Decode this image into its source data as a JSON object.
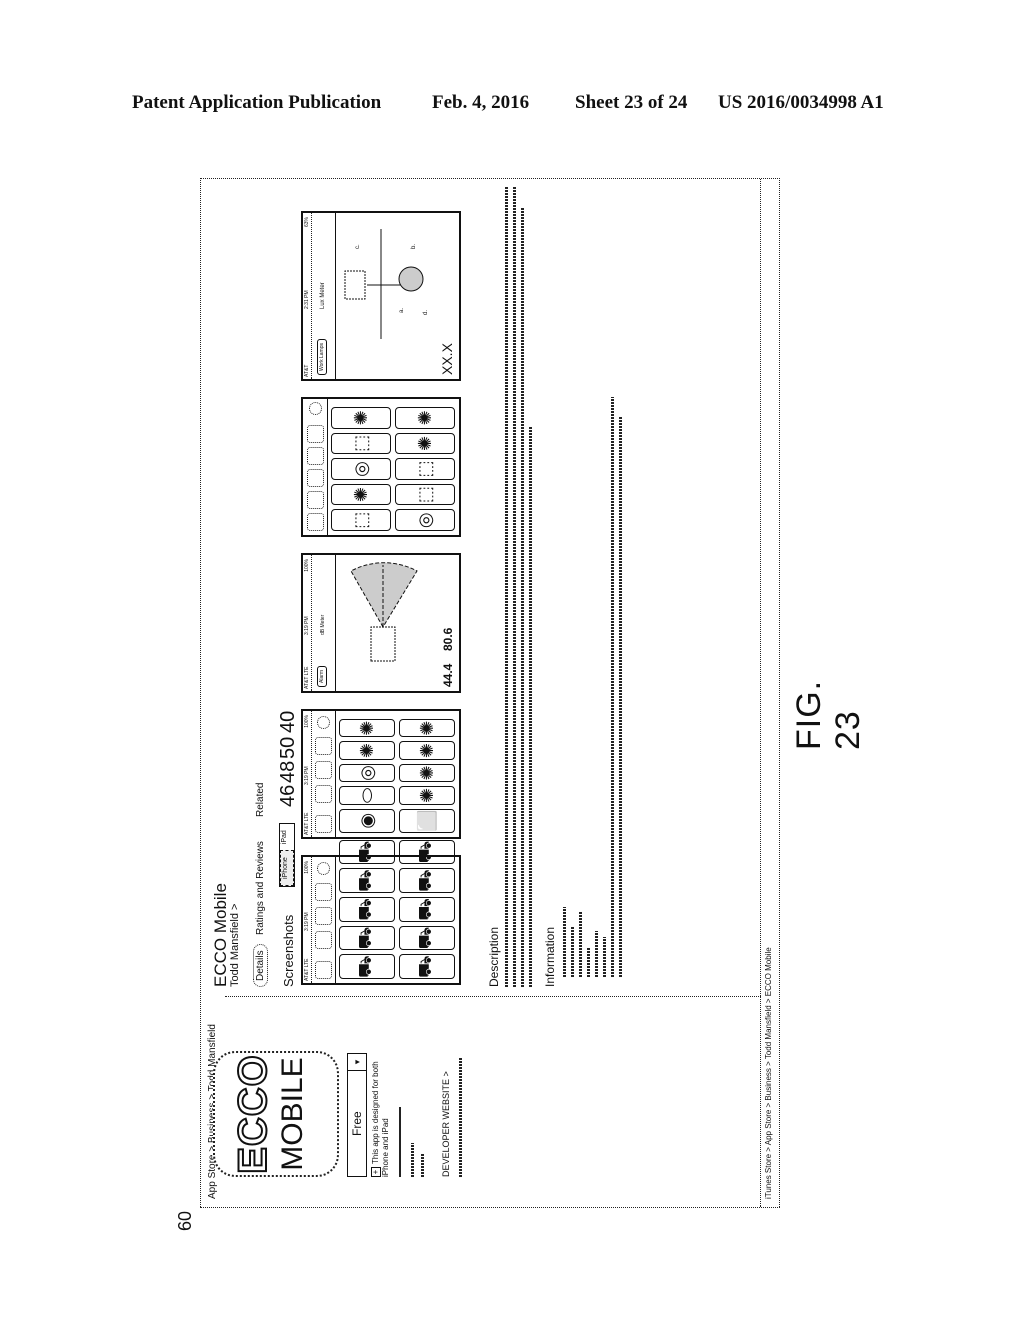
{
  "header": {
    "publication": "Patent Application Publication",
    "date": "Feb. 4, 2016",
    "sheet": "Sheet 23 of 24",
    "number": "US 2016/0034998 A1"
  },
  "figure": {
    "label": "FIG. 23"
  },
  "reference_numerals": {
    "app_icon": "60",
    "toolbar_button_1": "46",
    "toolbar_button_2": "48",
    "toolbar_button_3": "50",
    "toolbar_circle": "40"
  },
  "store": {
    "breadcrumb": "App Store > Business > Todd Mansfield",
    "footer_breadcrumb": "iTunes Store > App Store > Business > Todd Mansfield > ECCO Mobile"
  },
  "sidebar": {
    "icon_text_top": "ECCO",
    "icon_text_bottom": "MOBILE",
    "price_button": "Free",
    "dropdown_icon": "▾",
    "compat_icon": "+",
    "compat_text": "This app is designed for both iPhone and iPad",
    "developer_link": "DEVELOPER WEBSITE >"
  },
  "app": {
    "title": "ECCO Mobile",
    "developer": "Todd Mansfield >",
    "tabs": [
      {
        "label": "Details",
        "active": true
      },
      {
        "label": "Ratings and Reviews",
        "active": false
      },
      {
        "label": "Related",
        "active": false
      }
    ],
    "screenshots_label": "Screenshots",
    "device_toggle": [
      "iPhone",
      "iPad"
    ],
    "description_heading": "Description",
    "information_heading": "Information"
  },
  "screenshots": [
    {
      "carrier": "AT&T LTE",
      "time": "3:19 PM",
      "battery": "100%",
      "tiles": [
        "⛟",
        "⛟",
        "⛟",
        "⛟",
        "⛟",
        "⛟",
        "⛟",
        "⛟",
        "⛟",
        "⛟"
      ]
    },
    {
      "carrier": "AT&T LTE",
      "time": "3:19 PM",
      "battery": "100%",
      "tiles": [
        "◉",
        "⬭",
        "◎",
        "✺",
        "✺",
        "⬜",
        "✺",
        "✺",
        "✺",
        "✺"
      ]
    },
    {
      "carrier": "AT&T LTE",
      "time": "3:19 PM",
      "battery": "100%",
      "title": "dB Meter",
      "button": "Alarm",
      "readout_1": "44.4",
      "readout_2": "80.6"
    },
    {
      "tiles": [
        "⬚",
        "✺",
        "◎",
        "⬚",
        "✺",
        "◎",
        "⬚",
        "⬚",
        "✺",
        "✺"
      ]
    },
    {
      "carrier": "AT&T",
      "time": "2:31 PM",
      "battery": "63%",
      "title": "Lux Meter",
      "button": "Work Lamps",
      "readout": "XX.X",
      "labels": [
        "a.",
        "b.",
        "c.",
        "d."
      ]
    }
  ]
}
